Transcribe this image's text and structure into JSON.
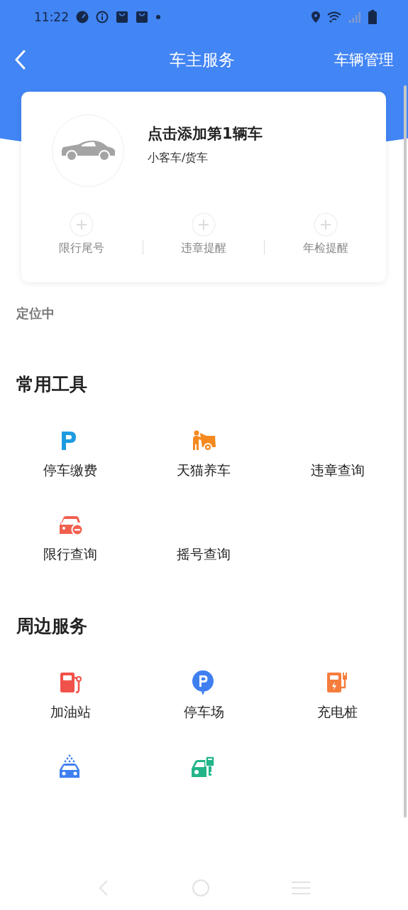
{
  "status_bar": {
    "time": "11:22"
  },
  "nav": {
    "title": "车主服务",
    "action": "车辆管理"
  },
  "vehicle_card": {
    "title": "点击添加第1辆车",
    "subtitle": "小客车/货车",
    "shortcuts": [
      {
        "label": "限行尾号"
      },
      {
        "label": "违章提醒"
      },
      {
        "label": "年检提醒"
      }
    ]
  },
  "location": "定位中",
  "sections": [
    {
      "title": "常用工具",
      "items": [
        {
          "kind": "parking-p",
          "label": "停车缴费"
        },
        {
          "kind": "mechanic",
          "label": "天猫养车"
        },
        {
          "kind": "none",
          "label": "违章查询"
        },
        {
          "kind": "car-minus",
          "label": "限行查询"
        },
        {
          "kind": "none",
          "label": "摇号查询"
        }
      ]
    },
    {
      "title": "周边服务",
      "items": [
        {
          "kind": "fuel",
          "label": "加油站"
        },
        {
          "kind": "parking-pin",
          "label": "停车场"
        },
        {
          "kind": "charger",
          "label": "充电桩"
        },
        {
          "kind": "car-wash"
        },
        {
          "kind": "car-key"
        }
      ]
    }
  ]
}
